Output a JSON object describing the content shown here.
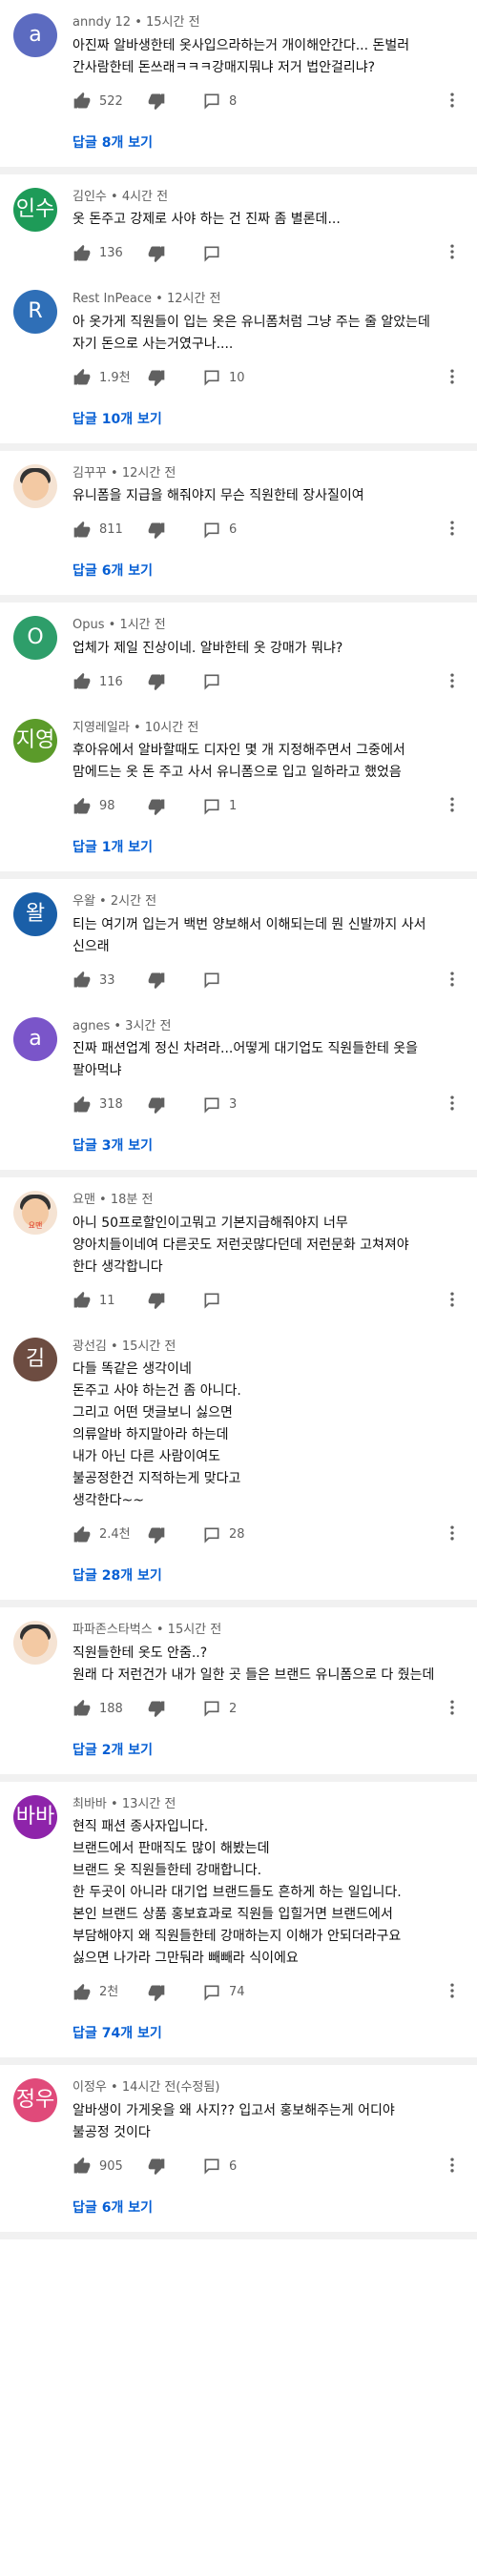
{
  "ui": {
    "reply_label": "답글",
    "replies_suffix": "개 보기",
    "separator": " • ",
    "icons": {
      "like": "thumb-up-icon",
      "dislike": "thumb-down-icon",
      "reply": "comment-icon",
      "more": "more-vert-icon"
    }
  },
  "threads": [
    {
      "comments": [
        {
          "id": "c1",
          "avatar": "a",
          "avatar_color": "#5c6bc0",
          "author": "anndy 12",
          "time": "15시간 전",
          "text": "아진짜 알바생한테 옷사입으라하는거 개이해안간다... 돈벌러 간사람한테 돈쓰래ㅋㅋㅋ강매지뭐냐 저거 법안걸리냐?",
          "likes": "522",
          "reply_count": "8"
        }
      ],
      "replies_count": "8"
    },
    {
      "comments": [
        {
          "id": "c2",
          "avatar": "인수",
          "avatar_color": "#1e9b58",
          "author": "김인수",
          "time": "4시간 전",
          "text": "옷 돈주고 강제로 사야 하는 건 진짜 좀 별론데...",
          "likes": "136",
          "reply_count": ""
        },
        {
          "id": "c3",
          "avatar": "R",
          "avatar_color": "#2f6fb7",
          "author": "Rest InPeace",
          "time": "12시간 전",
          "text": "아 옷가게 직원들이 입는 옷은 유니폼처럼 그냥 주는 줄 알았는데 자기 돈으로 사는거였구나....",
          "likes": "1.9천",
          "reply_count": "10"
        }
      ],
      "replies_count": "10"
    },
    {
      "comments": [
        {
          "id": "c4",
          "avatar": "",
          "avatar_color": "#ffffff",
          "avatar_image": "photo-avatar",
          "author": "김꾸꾸",
          "time": "12시간 전",
          "text": "유니폼을 지급을 해줘야지 무슨 직원한테 장사질이여",
          "likes": "811",
          "reply_count": "6"
        }
      ],
      "replies_count": "6"
    },
    {
      "comments": [
        {
          "id": "c5",
          "avatar": "O",
          "avatar_color": "#2e9e6a",
          "author": "Opus",
          "time": "1시간 전",
          "text": "업체가 제일 진상이네. 알바한테 옷 강매가 뭐냐?",
          "likes": "116",
          "reply_count": ""
        },
        {
          "id": "c6",
          "avatar": "지영",
          "avatar_color": "#5b9b2a",
          "author": "지영레일라",
          "time": "10시간 전",
          "text": "후아유에서 알바할때도 디자인 몇 개 지정해주면서 그중에서 맘에드는 옷 돈 주고 사서 유니폼으로 입고 일하라고 했었음",
          "likes": "98",
          "reply_count": "1"
        }
      ],
      "replies_count": "1"
    },
    {
      "comments": [
        {
          "id": "c7",
          "avatar": "왈",
          "avatar_color": "#1a5fa8",
          "author": "우왈",
          "time": "2시간 전",
          "text": "티는 여기꺼 입는거 백번 양보해서 이해되는데 뭔 신발까지 사서 신으래",
          "likes": "33",
          "reply_count": ""
        },
        {
          "id": "c8",
          "avatar": "a",
          "avatar_color": "#7a55c9",
          "author": "agnes",
          "time": "3시간 전",
          "text": "진짜 패션업계 정신 차려라...어떻게 대기업도 직원들한테 옷을 팔아먹냐",
          "likes": "318",
          "reply_count": "3"
        }
      ],
      "replies_count": "3"
    },
    {
      "comments": [
        {
          "id": "c9",
          "avatar": "요맨",
          "avatar_color": "#ffffff",
          "avatar_image": "photo-avatar",
          "author": "요맨",
          "time": "18분 전",
          "text": "아니 50프로할인이고뭐고 기본지급해줘야지 너무 양아치들이네여 다른곳도 저런곳많다던데 저런문화 고쳐져야 한다 생각합니다",
          "likes": "11",
          "reply_count": ""
        },
        {
          "id": "c10",
          "avatar": "김",
          "avatar_color": "#6d4c41",
          "author": "광선김",
          "time": "15시간 전",
          "text": "다들 똑같은 생각이네\n돈주고 사야 하는건 좀 아니다.\n그리고 어떤 댓글보니 싫으면\n의류알바 하지말아라 하는데\n내가 아닌 다른 사람이여도\n불공정한건 지적하는게 맞다고\n생각한다~~",
          "likes": "2.4천",
          "reply_count": "28"
        }
      ],
      "replies_count": "28"
    },
    {
      "comments": [
        {
          "id": "c11",
          "avatar": "",
          "avatar_color": "#ffffff",
          "avatar_image": "photo-avatar",
          "author": "파파존스타벅스",
          "time": "15시간 전",
          "text": "직원들한테 옷도 안줌..?\n원래 다 저런건가 내가 일한 곳 들은 브랜드 유니폼으로 다 줬는데",
          "likes": "188",
          "reply_count": "2"
        }
      ],
      "replies_count": "2"
    },
    {
      "comments": [
        {
          "id": "c12",
          "avatar": "바바",
          "avatar_color": "#8e24aa",
          "author": "최바바",
          "time": "13시간 전",
          "text": "현직 패션 종사자입니다.\n브랜드에서 판매직도 많이 해봤는데\n브랜드 옷 직원들한테 강매합니다.\n한 두곳이 아니라 대기업 브랜드들도 흔하게 하는 일입니다.\n본인 브랜드 상품 홍보효과로 직원들 입힐거면 브랜드에서 부담해야지 왜 직원들한테 강매하는지 이해가 안되더라구요 싫으면 나가라 그만둬라 빼빼라 식이에요",
          "likes": "2천",
          "reply_count": "74"
        }
      ],
      "replies_count": "74"
    },
    {
      "comments": [
        {
          "id": "c13",
          "avatar": "정우",
          "avatar_color": "#e04a7a",
          "author": "이정우",
          "time": "14시간 전(수정됨)",
          "text": "알바생이 가게옷을 왜 사지?? 입고서 홍보해주는게 어디야 불공정 것이다",
          "likes": "905",
          "reply_count": "6"
        }
      ],
      "replies_count": "6"
    }
  ]
}
